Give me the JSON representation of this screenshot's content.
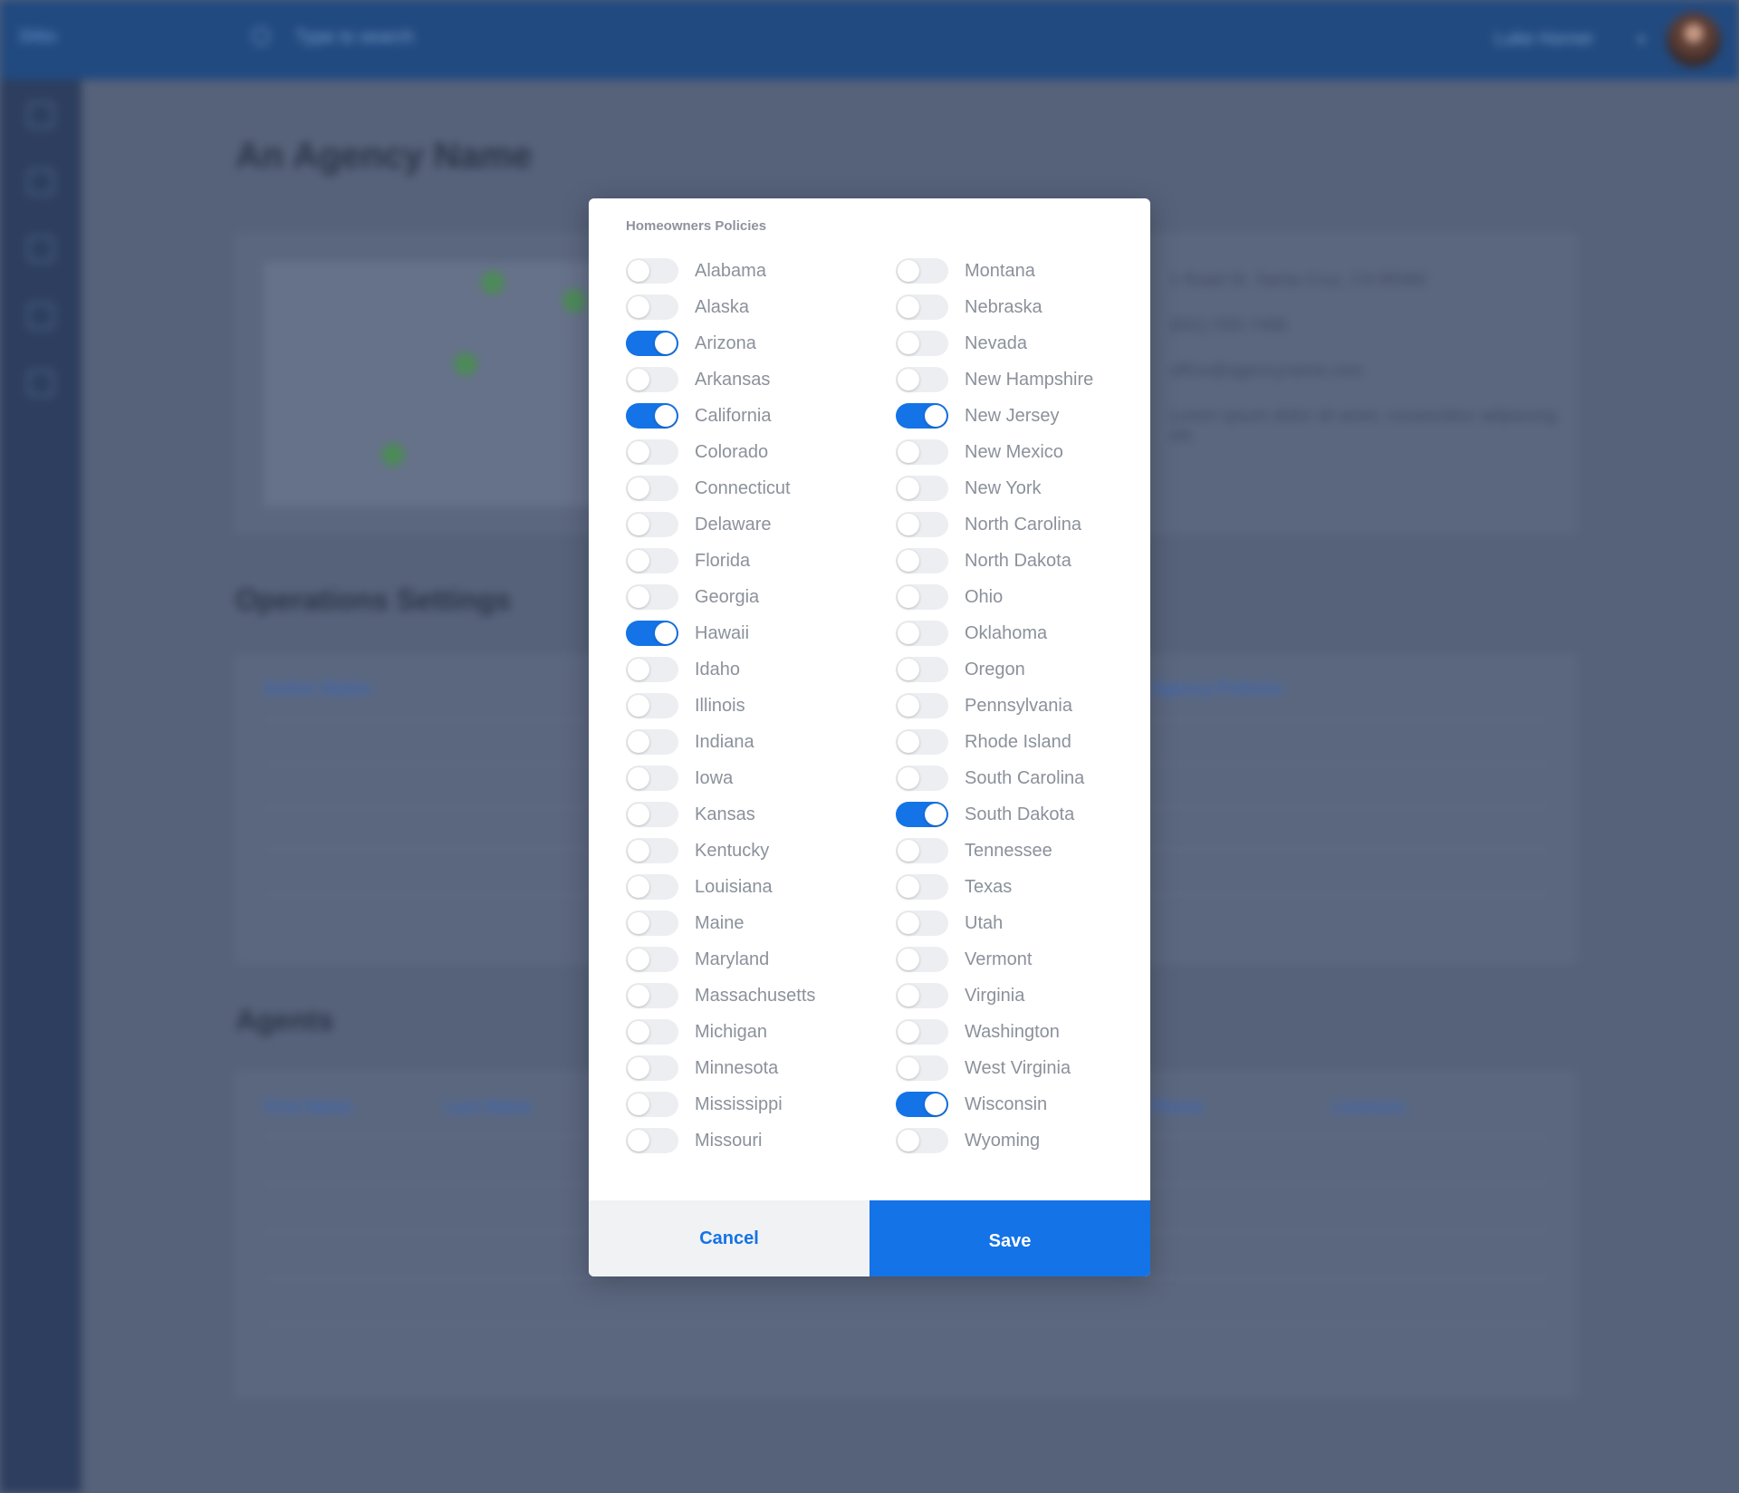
{
  "app": {
    "logo": "Ditto",
    "search_placeholder": "Type to search",
    "user_name": "Luke Horner",
    "page_title": "An Agency Name",
    "operations_title": "Operations Settings",
    "agents_title": "Agents",
    "active_states_label": "Active States",
    "agency_policies_label": "Agency Policies",
    "first_name_label": "First Name",
    "last_name_label": "Last Name",
    "phone_label": "Phone",
    "licenses_label": "Licenses",
    "address_text": "1 Road St. Santa Cruz, CA 95060",
    "phone_text": "(831) 555-7486",
    "email_text": "office@agencyname.com",
    "about_text": "Lorem ipsum dolor sit amet, consectetur adipiscing elit."
  },
  "modal": {
    "title": "Homeowners Policies",
    "cancel_label": "Cancel",
    "save_label": "Save",
    "left_states": [
      {
        "name": "Alabama",
        "on": false
      },
      {
        "name": "Alaska",
        "on": false
      },
      {
        "name": "Arizona",
        "on": true
      },
      {
        "name": "Arkansas",
        "on": false
      },
      {
        "name": "California",
        "on": true
      },
      {
        "name": "Colorado",
        "on": false
      },
      {
        "name": "Connecticut",
        "on": false
      },
      {
        "name": "Delaware",
        "on": false
      },
      {
        "name": "Florida",
        "on": false
      },
      {
        "name": "Georgia",
        "on": false
      },
      {
        "name": "Hawaii",
        "on": true
      },
      {
        "name": "Idaho",
        "on": false
      },
      {
        "name": "Illinois",
        "on": false
      },
      {
        "name": "Indiana",
        "on": false
      },
      {
        "name": "Iowa",
        "on": false
      },
      {
        "name": "Kansas",
        "on": false
      },
      {
        "name": "Kentucky",
        "on": false
      },
      {
        "name": "Louisiana",
        "on": false
      },
      {
        "name": "Maine",
        "on": false
      },
      {
        "name": "Maryland",
        "on": false
      },
      {
        "name": "Massachusetts",
        "on": false
      },
      {
        "name": "Michigan",
        "on": false
      },
      {
        "name": "Minnesota",
        "on": false
      },
      {
        "name": "Mississippi",
        "on": false
      },
      {
        "name": "Missouri",
        "on": false
      }
    ],
    "right_states": [
      {
        "name": "Montana",
        "on": false
      },
      {
        "name": "Nebraska",
        "on": false
      },
      {
        "name": "Nevada",
        "on": false
      },
      {
        "name": "New Hampshire",
        "on": false
      },
      {
        "name": "New Jersey",
        "on": true
      },
      {
        "name": "New Mexico",
        "on": false
      },
      {
        "name": "New York",
        "on": false
      },
      {
        "name": "North Carolina",
        "on": false
      },
      {
        "name": "North Dakota",
        "on": false
      },
      {
        "name": "Ohio",
        "on": false
      },
      {
        "name": "Oklahoma",
        "on": false
      },
      {
        "name": "Oregon",
        "on": false
      },
      {
        "name": "Pennsylvania",
        "on": false
      },
      {
        "name": "Rhode Island",
        "on": false
      },
      {
        "name": "South Carolina",
        "on": false
      },
      {
        "name": "South Dakota",
        "on": true
      },
      {
        "name": "Tennessee",
        "on": false
      },
      {
        "name": "Texas",
        "on": false
      },
      {
        "name": "Utah",
        "on": false
      },
      {
        "name": "Vermont",
        "on": false
      },
      {
        "name": "Virginia",
        "on": false
      },
      {
        "name": "Washington",
        "on": false
      },
      {
        "name": "West Virginia",
        "on": false
      },
      {
        "name": "Wisconsin",
        "on": true
      },
      {
        "name": "Wyoming",
        "on": false
      }
    ]
  },
  "colors": {
    "accent": "#1473e6",
    "topbar": "#214a80",
    "sidebar": "#2d3e5e",
    "toggle_off": "#eceef1"
  }
}
